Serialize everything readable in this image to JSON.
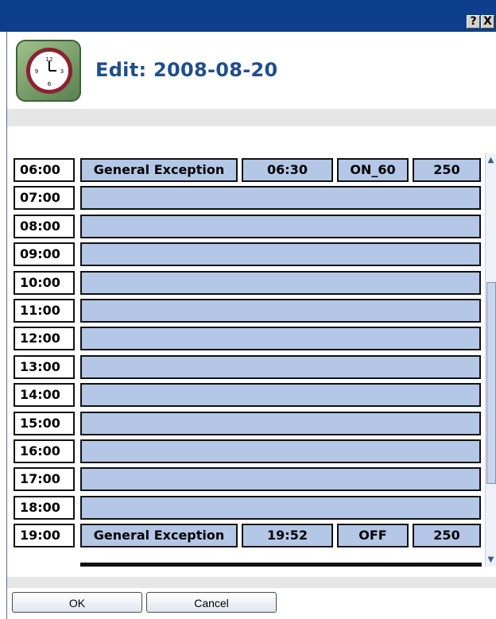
{
  "titlebar": {
    "help_label": "?",
    "close_label": "X"
  },
  "header": {
    "title": "Edit: 2008-08-20",
    "icon": "clock-icon"
  },
  "schedule": {
    "hours": [
      "06:00",
      "07:00",
      "08:00",
      "09:00",
      "10:00",
      "11:00",
      "12:00",
      "13:00",
      "14:00",
      "15:00",
      "16:00",
      "17:00",
      "18:00",
      "19:00"
    ],
    "entries": [
      {
        "hour": "06:00",
        "name": "General Exception",
        "time": "06:30",
        "state": "ON_60",
        "value": "250"
      },
      {
        "hour": "19:00",
        "name": "General Exception",
        "time": "19:52",
        "state": "OFF",
        "value": "250"
      }
    ]
  },
  "footer": {
    "ok_label": "OK",
    "cancel_label": "Cancel"
  },
  "colors": {
    "titlebar": "#0d3f8c",
    "slot_fill": "#b4c7e7",
    "title_text": "#1f4e8c"
  }
}
